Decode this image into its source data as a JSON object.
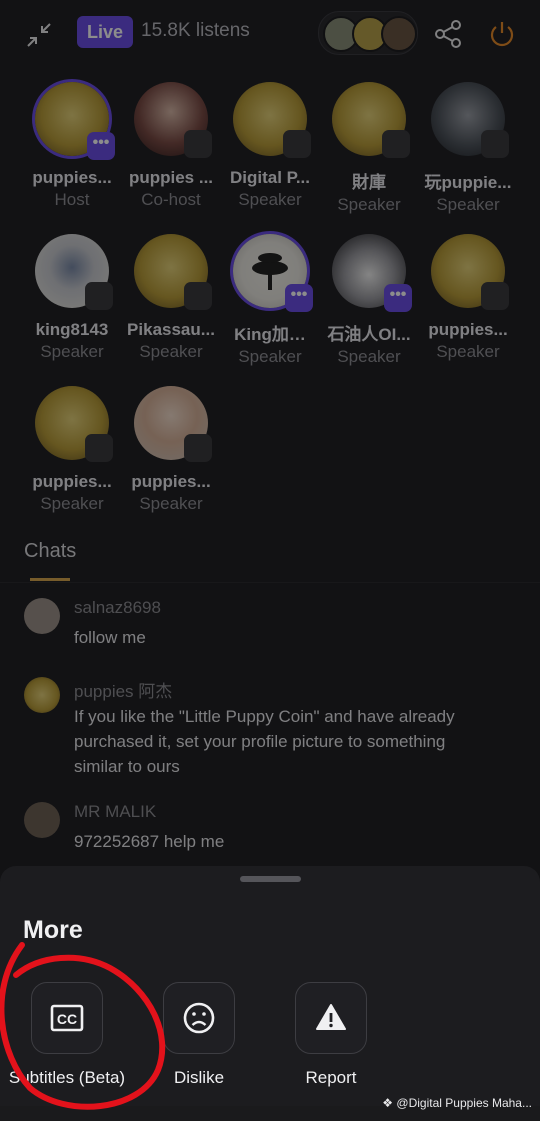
{
  "topbar": {
    "live_label": "Live",
    "listens": "15.8K listens"
  },
  "participants": [
    {
      "name": "puppies...",
      "role": "Host"
    },
    {
      "name": "puppies ...",
      "role": "Co-host"
    },
    {
      "name": "Digital P...",
      "role": "Speaker"
    },
    {
      "name": "財庫",
      "role": "Speaker"
    },
    {
      "name": "玩puppie...",
      "role": "Speaker"
    },
    {
      "name": "king8143",
      "role": "Speaker"
    },
    {
      "name": "Pikassau...",
      "role": "Speaker"
    },
    {
      "name": "King加…",
      "role": "Speaker"
    },
    {
      "name": "石油人OI...",
      "role": "Speaker"
    },
    {
      "name": "puppies...",
      "role": "Speaker"
    },
    {
      "name": "puppies...",
      "role": "Speaker"
    },
    {
      "name": "puppies...",
      "role": "Speaker"
    }
  ],
  "chats": {
    "tab_label": "Chats",
    "messages": [
      {
        "user": "salnaz8698",
        "text": "follow me"
      },
      {
        "user": "puppies 阿杰",
        "text": "If you like the \"Little Puppy Coin\" and have already purchased it, set your profile picture to something similar to ours"
      },
      {
        "user": "MR  MALIK",
        "text": "972252687 help me"
      }
    ]
  },
  "sheet": {
    "title": "More",
    "actions": [
      {
        "label": "Subtitles (Beta)",
        "icon": "cc-icon"
      },
      {
        "label": "Dislike",
        "icon": "sad-face-icon"
      },
      {
        "label": "Report",
        "icon": "warning-icon"
      }
    ]
  },
  "watermark": "@Digital Puppies Maha...",
  "colors": {
    "accent": "#6b4fe6",
    "tab_underline": "#d9a84e",
    "annotation": "#e3121b"
  }
}
